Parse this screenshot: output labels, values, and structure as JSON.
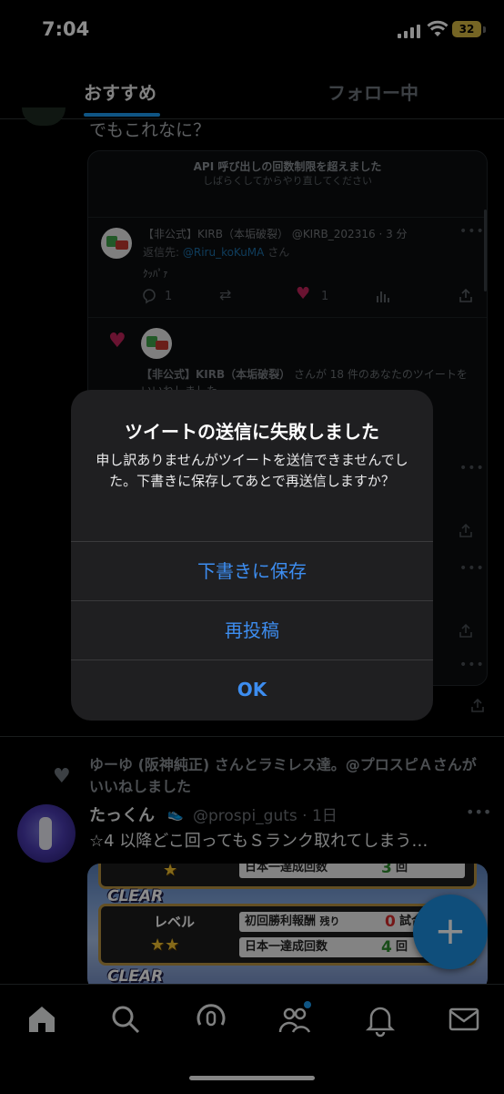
{
  "status_bar": {
    "time": "7:04",
    "battery": "32"
  },
  "tabs": {
    "active": "おすすめ",
    "inactive": "フォロー中"
  },
  "partial_tweet": {
    "text": "でもこれなに？"
  },
  "embedded": {
    "api_title": "API 呼び出しの回数制限を超えました",
    "api_sub": "しばらくしてからやり直してください",
    "tweet": {
      "name": "【非公式】KIRB（本垢破裂）",
      "handle": "@KIRB_202316",
      "time": "· 3 分",
      "reply_prefix": "返信先: ",
      "reply_to": "@Riru_koKuMA",
      "reply_suffix": " さん",
      "body": "ｸｯﾊﾟｧ",
      "reply_count": "1",
      "like_count": "1"
    },
    "notification": {
      "name": "【非公式】KIRB（本垢破裂）",
      "text": " さんが 18 件のあなたのツイートをいいねしました"
    }
  },
  "dialog": {
    "title": "ツイートの送信に失敗しました",
    "message": "申し訳ありませんがツイートを送信できませんでした。下書きに保存してあとで再送信しますか？",
    "save_draft": "下書きに保存",
    "repost": "再投稿",
    "ok": "OK"
  },
  "feed": {
    "social_context": "ゆーゆ (阪神純正) さんとラミレス達。@プロスピＡさんがいいねしました",
    "tweet": {
      "name": "たっくん",
      "handle": "@prospi_guts · 1日",
      "body": "☆4 以降どこ回ってもＳランク取れてしまう…"
    },
    "game_image": {
      "clear_label": "CLEAR",
      "level_label": "レベル",
      "row_top": {
        "label": "日本一達成回数",
        "value": "3",
        "unit": "回"
      },
      "row_first_win": {
        "label": "初回勝利報酬",
        "remaining": "残り",
        "value": "0",
        "unit": "試合"
      },
      "row_bottom": {
        "label": "日本一達成回数",
        "value": "4",
        "unit": "回"
      }
    }
  },
  "fab": {
    "label": "+"
  },
  "colors": {
    "accent": "#1d9bf0",
    "like": "#c0245a",
    "dialog_bg": "#1f1f21",
    "dialog_button": "#3d8df0"
  },
  "nav": {
    "items": [
      {
        "icon": "home-icon"
      },
      {
        "icon": "search-icon"
      },
      {
        "icon": "spaces-icon"
      },
      {
        "icon": "communities-icon"
      },
      {
        "icon": "notifications-icon"
      },
      {
        "icon": "messages-icon"
      }
    ]
  }
}
